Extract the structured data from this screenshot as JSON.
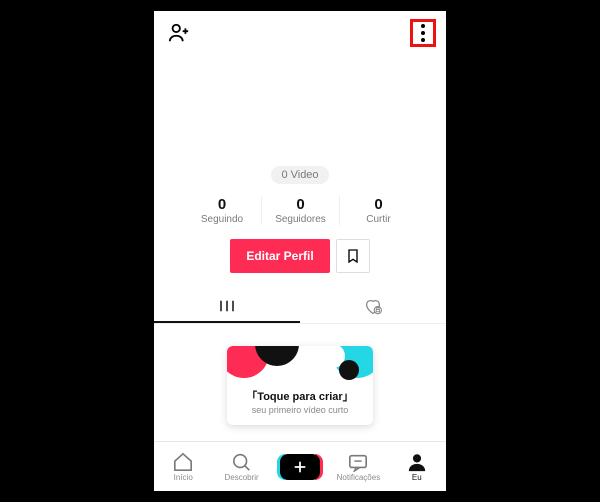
{
  "video_pill": "0 Video",
  "stats": {
    "following": {
      "count": "0",
      "label": "Seguindo"
    },
    "followers": {
      "count": "0",
      "label": "Seguidores"
    },
    "likes": {
      "count": "0",
      "label": "Curtir"
    }
  },
  "buttons": {
    "edit_profile": "Editar Perfil"
  },
  "promo": {
    "title": "「Toque para criar」",
    "subtitle": "seu primeiro vídeo curto"
  },
  "nav": {
    "home": "Início",
    "discover": "Descobrir",
    "inbox": "Notificações",
    "me": "Eu"
  },
  "colors": {
    "primary": "#fe2c55",
    "teal": "#25d6e4",
    "highlight_box": "#ee1111"
  }
}
